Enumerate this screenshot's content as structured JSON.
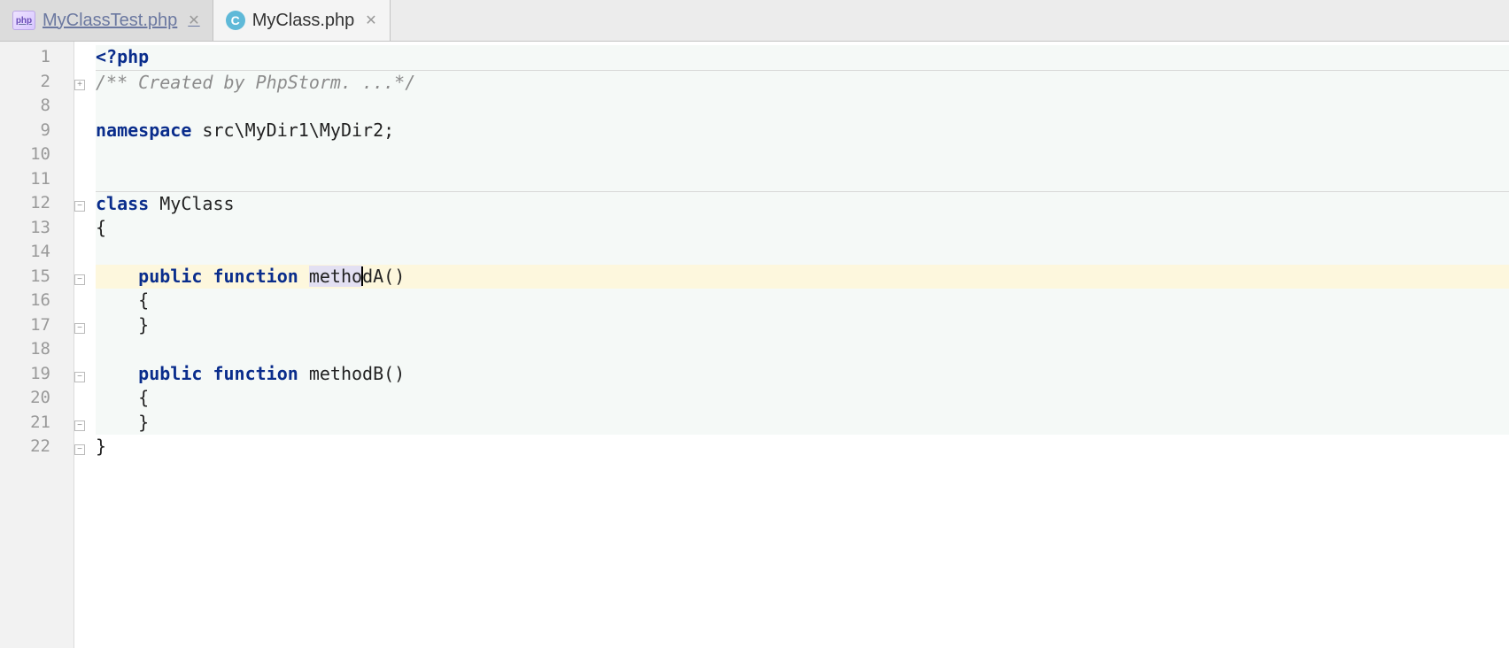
{
  "tabs": [
    {
      "label": "MyClassTest.php",
      "active": false,
      "icon": "php"
    },
    {
      "label": "MyClass.php",
      "active": true,
      "icon": "C"
    }
  ],
  "gutter_line_numbers": [
    "1",
    "2",
    "8",
    "9",
    "10",
    "11",
    "12",
    "13",
    "14",
    "15",
    "16",
    "17",
    "18",
    "19",
    "20",
    "21",
    "22"
  ],
  "fold_markers": {
    "1": "plus",
    "6": "minus",
    "9": "minus",
    "11": "minus",
    "13": "minus",
    "15": "minus",
    "16": "minus"
  },
  "code": {
    "open_tag": "<?php",
    "doc_comment": "/** Created by PhpStorm. ...*/",
    "namespace_kw": "namespace",
    "namespace_name": " src\\MyDir1\\MyDir2;",
    "class_kw": "class",
    "class_name": " MyClass",
    "brace_open": "{",
    "brace_close": "}",
    "indent1": "    ",
    "indent2": "        ",
    "public_kw": "public",
    "function_kw": "function",
    "space": " ",
    "methodA_prefix": "metho",
    "methodA_suffix": "dA",
    "methodA_parens": "()",
    "methodB_name": "methodB",
    "methodB_parens": "()"
  },
  "highlighted_line_index": 9,
  "caret_after": "metho"
}
